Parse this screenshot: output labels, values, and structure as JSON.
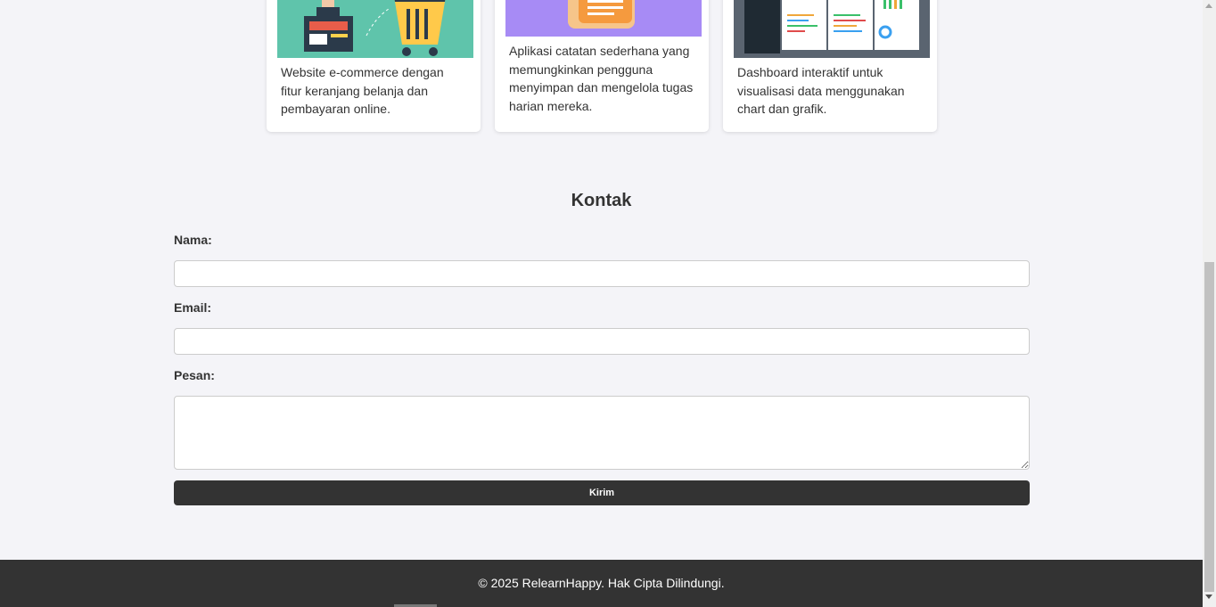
{
  "projects": [
    {
      "description": "Website e-commerce dengan fitur keranjang belanja dan pembayaran online."
    },
    {
      "description": "Aplikasi catatan sederhana yang memungkinkan pengguna menyimpan dan mengelola tugas harian mereka."
    },
    {
      "description": "Dashboard interaktif untuk visualisasi data menggunakan chart dan grafik."
    }
  ],
  "contact": {
    "title": "Kontak",
    "name_label": "Nama:",
    "email_label": "Email:",
    "message_label": "Pesan:",
    "submit_label": "Kirim"
  },
  "footer": {
    "text": "© 2025 RelearnHappy. Hak Cipta Dilindungi."
  },
  "colors": {
    "background": "#f4f4f8",
    "dark": "#333333",
    "card": "#ffffff",
    "ecommerce_thumb": "#5fc4ab",
    "notes_thumb": "#a78bf5",
    "dashboard_thumb": "#5a6470"
  }
}
